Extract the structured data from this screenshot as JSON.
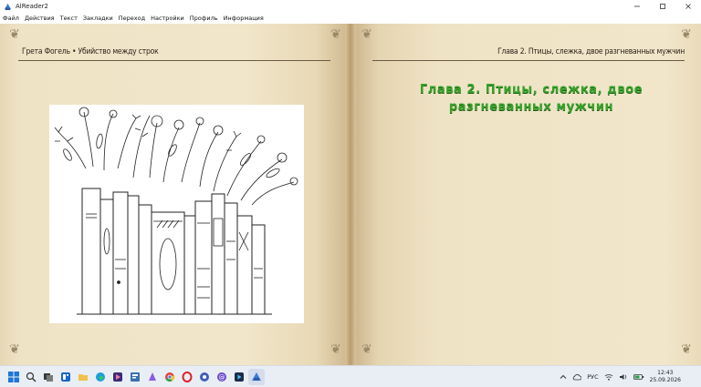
{
  "window": {
    "title": "AlReader2"
  },
  "menu": [
    "Файл",
    "Действия",
    "Текст",
    "Закладки",
    "Переход",
    "Настройки",
    "Профиль",
    "Информация"
  ],
  "book": {
    "left_header": "Грета Фогель • Убийство между строк",
    "right_header": "Глава 2. Птицы, слежка, двое разгневанных мужчин",
    "chapter_title": "Глава 2. Птицы, слежка, двое разгневанных мужчин"
  },
  "taskbar": {
    "language": "РУС",
    "time": "12:43",
    "date": "25.09.2026"
  },
  "colors": {
    "accent_green": "#37a12a",
    "page": "#f1e6ca",
    "taskbar": "#e9eef5"
  }
}
